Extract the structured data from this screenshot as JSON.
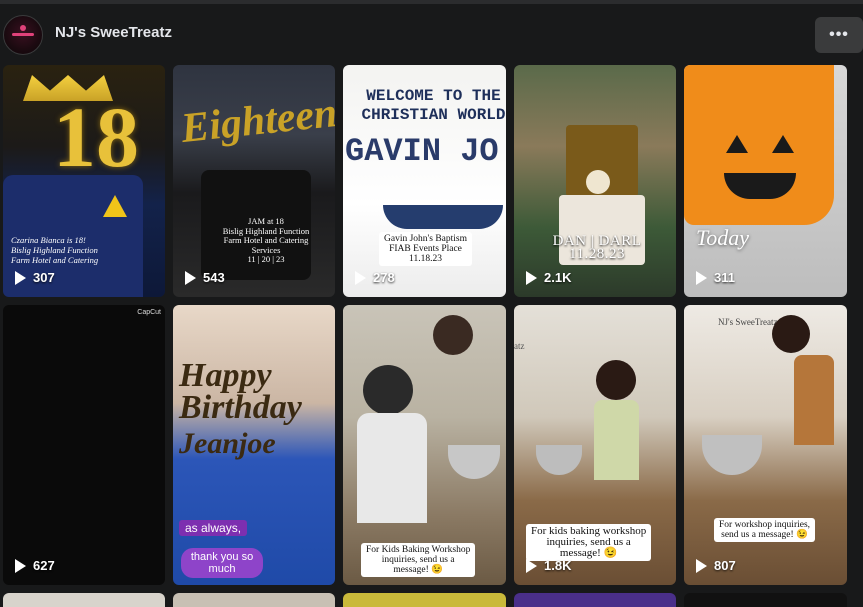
{
  "page": {
    "name": "NJ's SweeTreatz",
    "more_label": "•••"
  },
  "reels": [
    {
      "views": "307",
      "overlay": "Czarina Bianca is 18!\nBislig Highland Function\nFarm Hotel and Catering",
      "topper": "18"
    },
    {
      "views": "543",
      "overlay": "JAM at 18\nBislig Highland Function\nFarm Hotel and Catering\nServices\n11 | 20 | 23",
      "topper": "Eighteen"
    },
    {
      "views": "278",
      "sign": "WELCOME TO THE CHRISTIAN WORLD",
      "sign_name": "GAVIN JO",
      "caption": "Gavin John's Baptism\nFIAB Events Place\n11.18.23"
    },
    {
      "views": "2.1K",
      "overlay": "DAN | DARL\n11.28.23"
    },
    {
      "views": "311",
      "overlay": "Today"
    },
    {
      "views": "627",
      "badge": "CapCut"
    },
    {
      "views": "",
      "topper": "Happy Birthday",
      "topper2": "Jeanjoe",
      "caption": "as always,",
      "caption2": "thank you so much"
    },
    {
      "views": "",
      "caption": "For Kids Baking Workshop\ninquiries, send us a\nmessage! 😉"
    },
    {
      "views": "1.8K",
      "caption": "For kids baking workshop\ninquiries, send us a\nmessage! 😉",
      "sign": "atz"
    },
    {
      "views": "807",
      "caption": "For workshop inquiries,\nsend us a message! 😉",
      "sign": "NJ's SweeTreatz"
    }
  ],
  "colors": {
    "background": "#18191a",
    "button": "#3a3b3c",
    "text": "#e4e6eb"
  }
}
